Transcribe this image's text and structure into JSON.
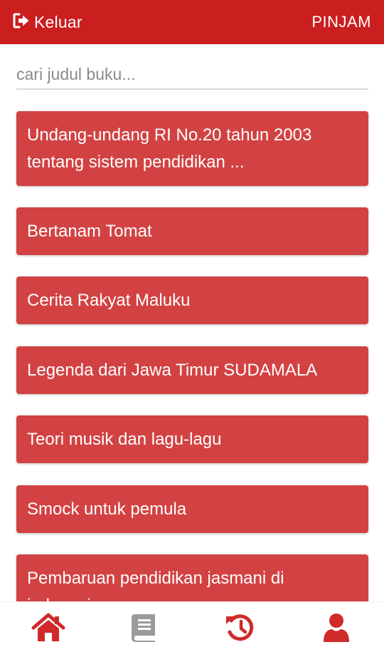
{
  "header": {
    "logout_label": "Keluar",
    "borrow_label": "PINJAM",
    "bar_color": "#cb1e1f"
  },
  "search": {
    "placeholder": "cari judul buku..."
  },
  "books": [
    {
      "title": "Undang-undang RI No.20 tahun 2003 tentang sistem pendidikan ..."
    },
    {
      "title": "Bertanam Tomat"
    },
    {
      "title": "Cerita Rakyat Maluku"
    },
    {
      "title": "Legenda dari Jawa Timur SUDAMALA"
    },
    {
      "title": "Teori musik dan lagu-lagu"
    },
    {
      "title": "Smock untuk pemula"
    },
    {
      "title": "Pembaruan pendidikan jasmani di indonesia"
    }
  ],
  "bottom_nav": [
    {
      "icon": "home-icon",
      "color": "#d02a2a"
    },
    {
      "icon": "book-icon",
      "color": "#9a9a9a"
    },
    {
      "icon": "history-icon",
      "color": "#d02a2a"
    },
    {
      "icon": "user-icon",
      "color": "#d02a2a"
    }
  ],
  "item_color": "#d24243"
}
